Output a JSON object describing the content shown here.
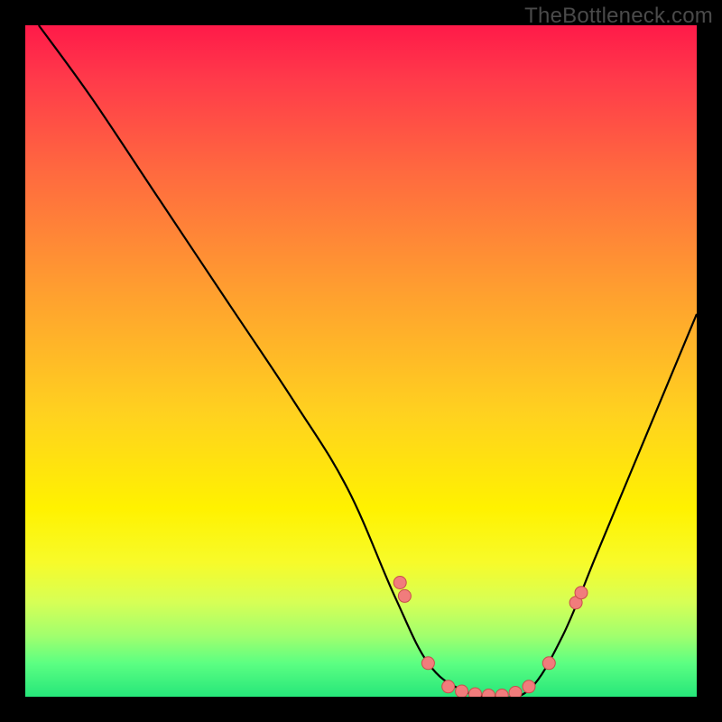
{
  "watermark": "TheBottleneck.com",
  "colors": {
    "frame": "#000000",
    "gradient_top": "#ff1a49",
    "gradient_mid": "#fff200",
    "gradient_bottom": "#26e67a",
    "curve": "#000000",
    "dot_fill": "#f17c7c",
    "dot_stroke": "#c94d4d"
  },
  "chart_data": {
    "type": "line",
    "title": "",
    "xlabel": "",
    "ylabel": "",
    "xlim": [
      0,
      100
    ],
    "ylim": [
      0,
      100
    ],
    "grid": false,
    "legend": false,
    "series": [
      {
        "name": "curve",
        "x": [
          2,
          10,
          20,
          30,
          40,
          48,
          55,
          60,
          65,
          70,
          75,
          80,
          85,
          90,
          100
        ],
        "y": [
          100,
          89,
          74,
          59,
          44,
          31,
          15,
          5,
          1,
          0,
          1,
          9,
          21,
          33,
          57
        ],
        "annotations_note": "y is bottleneck percentage; 0 = green floor, 100 = top edge"
      }
    ],
    "markers": [
      {
        "x": 55.8,
        "y": 17
      },
      {
        "x": 56.5,
        "y": 15
      },
      {
        "x": 60.0,
        "y": 5
      },
      {
        "x": 63.0,
        "y": 1.5
      },
      {
        "x": 65.0,
        "y": 0.8
      },
      {
        "x": 67.0,
        "y": 0.4
      },
      {
        "x": 69.0,
        "y": 0.2
      },
      {
        "x": 71.0,
        "y": 0.2
      },
      {
        "x": 73.0,
        "y": 0.6
      },
      {
        "x": 75.0,
        "y": 1.5
      },
      {
        "x": 78.0,
        "y": 5
      },
      {
        "x": 82.0,
        "y": 14
      },
      {
        "x": 82.8,
        "y": 15.5
      }
    ]
  }
}
